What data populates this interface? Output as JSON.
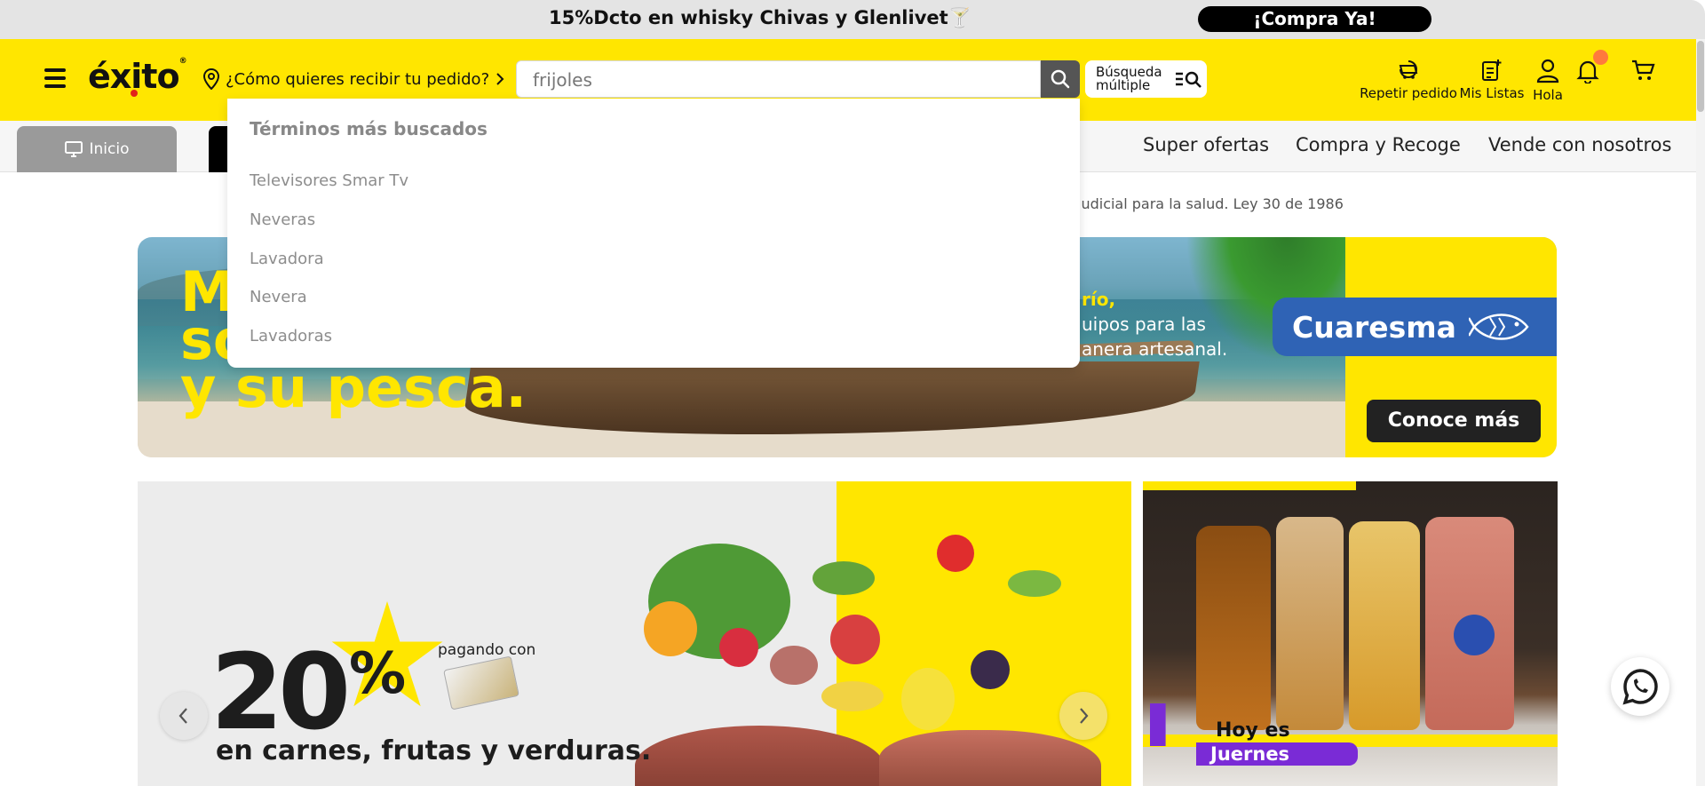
{
  "promo_bar": {
    "text": "15%Dcto en whisky Chivas y Glenlivet🍸",
    "cta": "¡Compra Ya!"
  },
  "header": {
    "logo": "éxito",
    "delivery_prompt": "¿Cómo quieres recibir tu pedido?",
    "search": {
      "value": "frijoles",
      "placeholder": ""
    },
    "multi_search_label": "Búsqueda múltiple",
    "actions": [
      {
        "label": "Repetir pedido",
        "icon": "repeat-order-icon"
      },
      {
        "label": "Mis Listas",
        "icon": "list-icon"
      },
      {
        "label": "Hola",
        "icon": "user-icon"
      },
      {
        "label": "",
        "icon": "bell-icon"
      },
      {
        "label": "",
        "icon": "cart-icon"
      }
    ]
  },
  "nav": {
    "inicio": "Inicio",
    "links": [
      "Super ofertas",
      "Compra y Recoge",
      "Vende con nosotros"
    ]
  },
  "legal_notice": "judicial para la salud. Ley 30 de 1986",
  "hero": {
    "title_lines": [
      "Mi",
      "so",
      "y su pesca."
    ],
    "subtitle_lines": [
      "río,",
      "uipos para las",
      "anera artesanal."
    ],
    "badge": "Cuaresma",
    "cta": "Conoce más"
  },
  "promo_left": {
    "big_number": "20",
    "percent": "%",
    "paying_with": "pagando con",
    "caption": "en carnes, frutas y verduras."
  },
  "promo_right": {
    "line1": "Hoy es",
    "line2": "Juernes"
  },
  "dropdown": {
    "title": "Términos más buscados",
    "items": [
      "Televisores Smar Tv",
      "Neveras",
      "Lavadora",
      "Nevera",
      "Lavadoras"
    ]
  },
  "colors": {
    "brand_yellow": "#ffe600",
    "accent_dark": "#111111",
    "notification": "#ff7a3d",
    "cuaresma_blue": "#2f63b5",
    "juernes_purple": "#7a2bd6"
  }
}
